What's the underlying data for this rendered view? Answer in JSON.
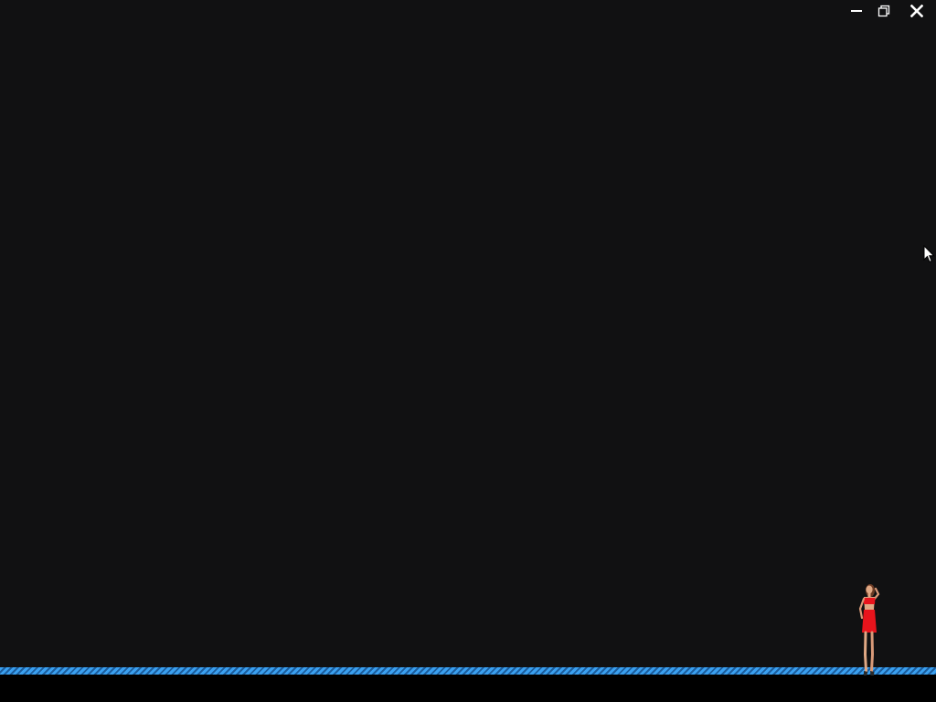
{
  "window": {
    "background_color": "#111112",
    "controls": {
      "minimize_icon": "minimize-icon",
      "restore_icon": "restore-icon",
      "close_icon": "close-icon"
    }
  },
  "scene": {
    "floor_color": "#3aa0f0",
    "character": {
      "icon": "character-figure",
      "outfit_color": "#e8141c"
    }
  }
}
